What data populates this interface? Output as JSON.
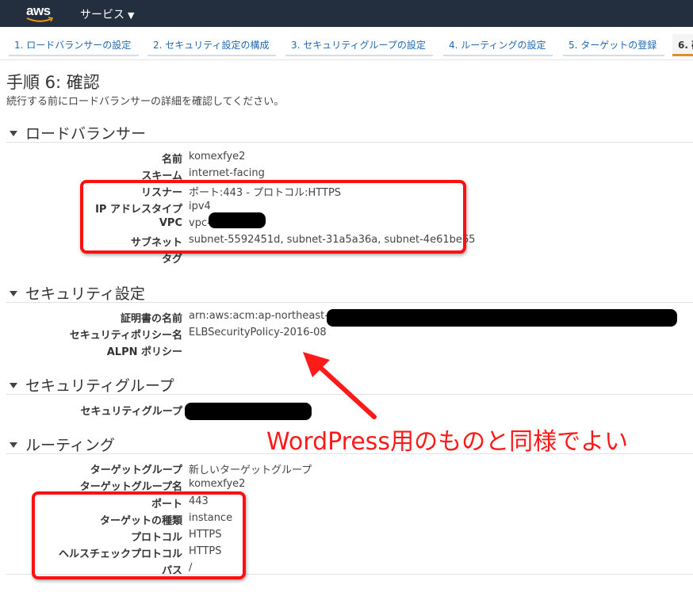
{
  "topnav": {
    "logo_text": "aws",
    "services_label": "サービス",
    "caret": "▼"
  },
  "steps": [
    "1. ロードバランサーの設定",
    "2. セキュリティ設定の構成",
    "3. セキュリティグループの設定",
    "4. ルーティングの設定",
    "5. ターゲットの登録",
    "6. 確"
  ],
  "page": {
    "title": "手順 6: 確認",
    "subtitle": "続行する前にロードバランサーの詳細を確認してください。"
  },
  "sections": {
    "lb": {
      "heading": "ロードバランサー",
      "rows": [
        {
          "label": "名前",
          "value": "komexfye2"
        },
        {
          "label": "スキーム",
          "value": "internet-facing"
        },
        {
          "label": "リスナー",
          "value": "ポート:443 - プロトコル:HTTPS"
        },
        {
          "label": "IP アドレスタイプ",
          "value": "ipv4"
        },
        {
          "label": "VPC",
          "value": "vpc-"
        },
        {
          "label": "サブネット",
          "value": "subnet-5592451d, subnet-31a5a36a, subnet-4e61be65"
        },
        {
          "label": "タグ",
          "value": ""
        }
      ]
    },
    "security": {
      "heading": "セキュリティ設定",
      "rows": [
        {
          "label": "証明書の名前",
          "value": "arn:aws:acm:ap-northeast-1:"
        },
        {
          "label": "セキュリティポリシー名",
          "value": "ELBSecurityPolicy-2016-08"
        },
        {
          "label": "ALPN ポリシー",
          "value": ""
        }
      ]
    },
    "sg": {
      "heading": "セキュリティグループ",
      "rows": [
        {
          "label": "セキュリティグループ",
          "value": ""
        }
      ]
    },
    "routing": {
      "heading": "ルーティング",
      "rows": [
        {
          "label": "ターゲットグループ",
          "value": "新しいターゲットグループ"
        },
        {
          "label": "ターゲットグループ名",
          "value": "komexfye2"
        },
        {
          "label": "ポート",
          "value": "443"
        },
        {
          "label": "ターゲットの種類",
          "value": "instance"
        },
        {
          "label": "プロトコル",
          "value": "HTTPS"
        },
        {
          "label": "ヘルスチェックプロトコル",
          "value": "HTTPS"
        },
        {
          "label": "パス",
          "value": "/"
        }
      ]
    }
  },
  "annotation": {
    "text": "WordPress用のものと同様でよい",
    "color": "#ff1a1a"
  },
  "colors": {
    "nav_bg": "#232f3e",
    "aws_orange": "#ff9900",
    "link": "#2169b0",
    "highlight": "#ff1010",
    "active_tab": "#e48c2e"
  }
}
